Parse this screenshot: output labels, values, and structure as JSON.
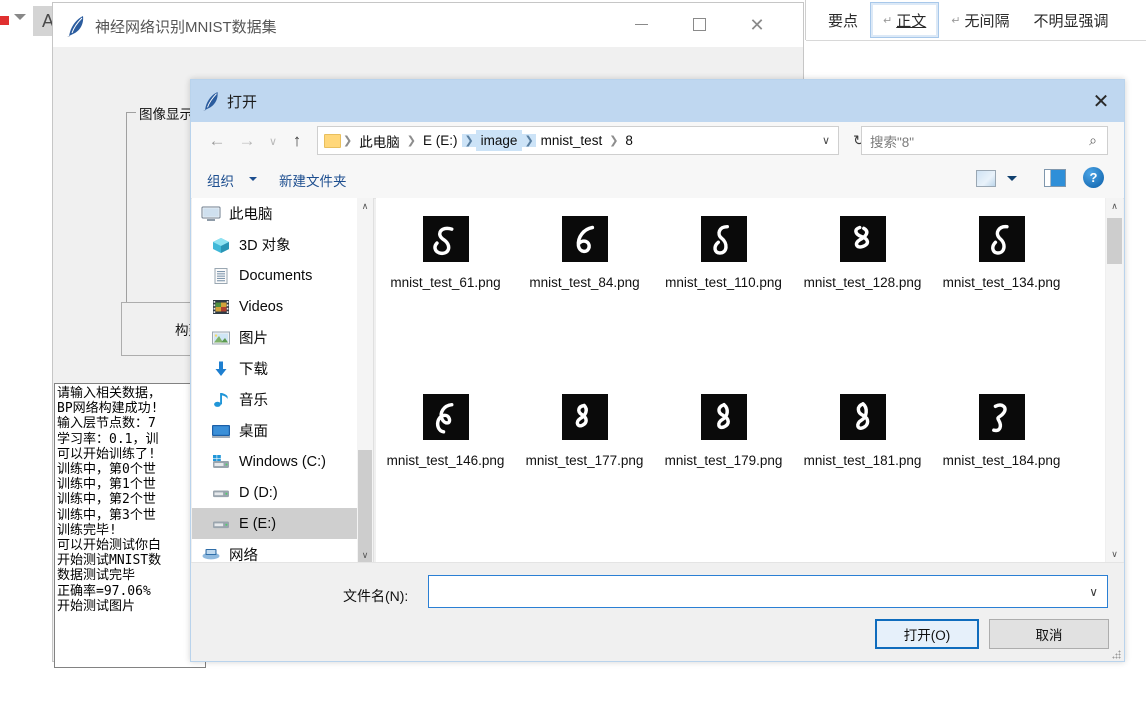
{
  "ribbon": {
    "styles": [
      {
        "label": "要点",
        "pilcrow": false,
        "selected": false
      },
      {
        "label": "正文",
        "pilcrow": true,
        "selected": true
      },
      {
        "label": "无间隔",
        "pilcrow": true,
        "selected": false
      },
      {
        "label": "不明显强调",
        "pilcrow": false,
        "selected": false
      }
    ],
    "font_color_icon": "A",
    "caret_icon": "caret-down-icon"
  },
  "tk_window": {
    "title": "神经网络识别MNIST数据集",
    "icon": "python-feather-icon",
    "minimize": "—",
    "maximize": "□",
    "close": "✕",
    "image_frame_label": "图像显示",
    "build_button": "构建网络",
    "log_lines": [
      "请输入相关数据，",
      "BP网络构建成功!",
      "输入层节点数：7",
      "学习率：0.1，训",
      "可以开始训练了!",
      "训练中，第0个世",
      "训练中，第1个世",
      "训练中，第2个世",
      "训练中，第3个世",
      "训练完毕!",
      "可以开始测试你白",
      "开始测试MNIST数",
      "数据测试完毕",
      "正确率=97.06%",
      "开始测试图片"
    ]
  },
  "dialog": {
    "title": "打开",
    "icon": "python-feather-icon",
    "close_label": "✕",
    "nav": {
      "back_icon": "arrow-left-icon",
      "forward_icon": "arrow-right-icon",
      "history_icon": "chevron-down-icon",
      "up_icon": "arrow-up-icon"
    },
    "breadcrumb": {
      "folder_icon": "folder-icon",
      "segments": [
        {
          "label": "此电脑",
          "highlight": false
        },
        {
          "label": "E (E:)",
          "highlight": false
        },
        {
          "label": "image",
          "highlight": true
        },
        {
          "label": "mnist_test",
          "highlight": false
        },
        {
          "label": "8",
          "highlight": false
        }
      ],
      "dropdown_icon": "chevron-down-icon",
      "refresh_icon": "refresh-icon"
    },
    "search": {
      "placeholder": "搜索\"8\"",
      "icon": "search-icon"
    },
    "toolbar": {
      "organize": "组织",
      "organize_caret": "caret-down-icon",
      "new_folder": "新建文件夹",
      "view_icon": "view-layout-icon",
      "view_caret": "caret-down-icon",
      "preview_pane_icon": "preview-pane-icon",
      "help_icon": "help-icon",
      "help_label": "?"
    },
    "nav_pane": {
      "items": [
        {
          "label": "此电脑",
          "icon": "this-pc-icon",
          "selected": false,
          "root": true
        },
        {
          "label": "3D 对象",
          "icon": "3d-objects-icon",
          "selected": false,
          "root": false
        },
        {
          "label": "Documents",
          "icon": "documents-icon",
          "selected": false,
          "root": false
        },
        {
          "label": "Videos",
          "icon": "videos-icon",
          "selected": false,
          "root": false
        },
        {
          "label": "图片",
          "icon": "pictures-icon",
          "selected": false,
          "root": false
        },
        {
          "label": "下载",
          "icon": "downloads-icon",
          "selected": false,
          "root": false
        },
        {
          "label": "音乐",
          "icon": "music-icon",
          "selected": false,
          "root": false
        },
        {
          "label": "桌面",
          "icon": "desktop-icon",
          "selected": false,
          "root": false
        },
        {
          "label": "Windows (C:)",
          "icon": "windows-drive-icon",
          "selected": false,
          "root": false
        },
        {
          "label": "D (D:)",
          "icon": "drive-icon",
          "selected": false,
          "root": false
        },
        {
          "label": "E (E:)",
          "icon": "drive-icon",
          "selected": true,
          "root": false
        },
        {
          "label": "网络",
          "icon": "network-icon",
          "selected": false,
          "root": true
        }
      ],
      "scrollbar_up": "chevron-up-icon",
      "scrollbar_down": "chevron-down-icon"
    },
    "files": {
      "rows": [
        [
          {
            "name": "mnist_test_61.png",
            "digit": "8",
            "variant": 0
          },
          {
            "name": "mnist_test_84.png",
            "digit": "8",
            "variant": 1
          },
          {
            "name": "mnist_test_110.png",
            "digit": "8",
            "variant": 2
          },
          {
            "name": "mnist_test_128.png",
            "digit": "8",
            "variant": 3
          },
          {
            "name": "mnist_test_134.png",
            "digit": "8",
            "variant": 4
          }
        ],
        [
          {
            "name": "mnist_test_146.png",
            "digit": "8",
            "variant": 5
          },
          {
            "name": "mnist_test_177.png",
            "digit": "8",
            "variant": 6
          },
          {
            "name": "mnist_test_179.png",
            "digit": "8",
            "variant": 7
          },
          {
            "name": "mnist_test_181.png",
            "digit": "8",
            "variant": 8
          },
          {
            "name": "mnist_test_184.png",
            "digit": "8",
            "variant": 9
          }
        ]
      ],
      "scrollbar_up": "chevron-up-icon",
      "scrollbar_down": "chevron-down-icon"
    },
    "bottom": {
      "filename_label": "文件名(N):",
      "filename_value": "",
      "filename_dropdown_icon": "chevron-down-icon",
      "open_button": "打开(O)",
      "cancel_button": "取消"
    }
  }
}
